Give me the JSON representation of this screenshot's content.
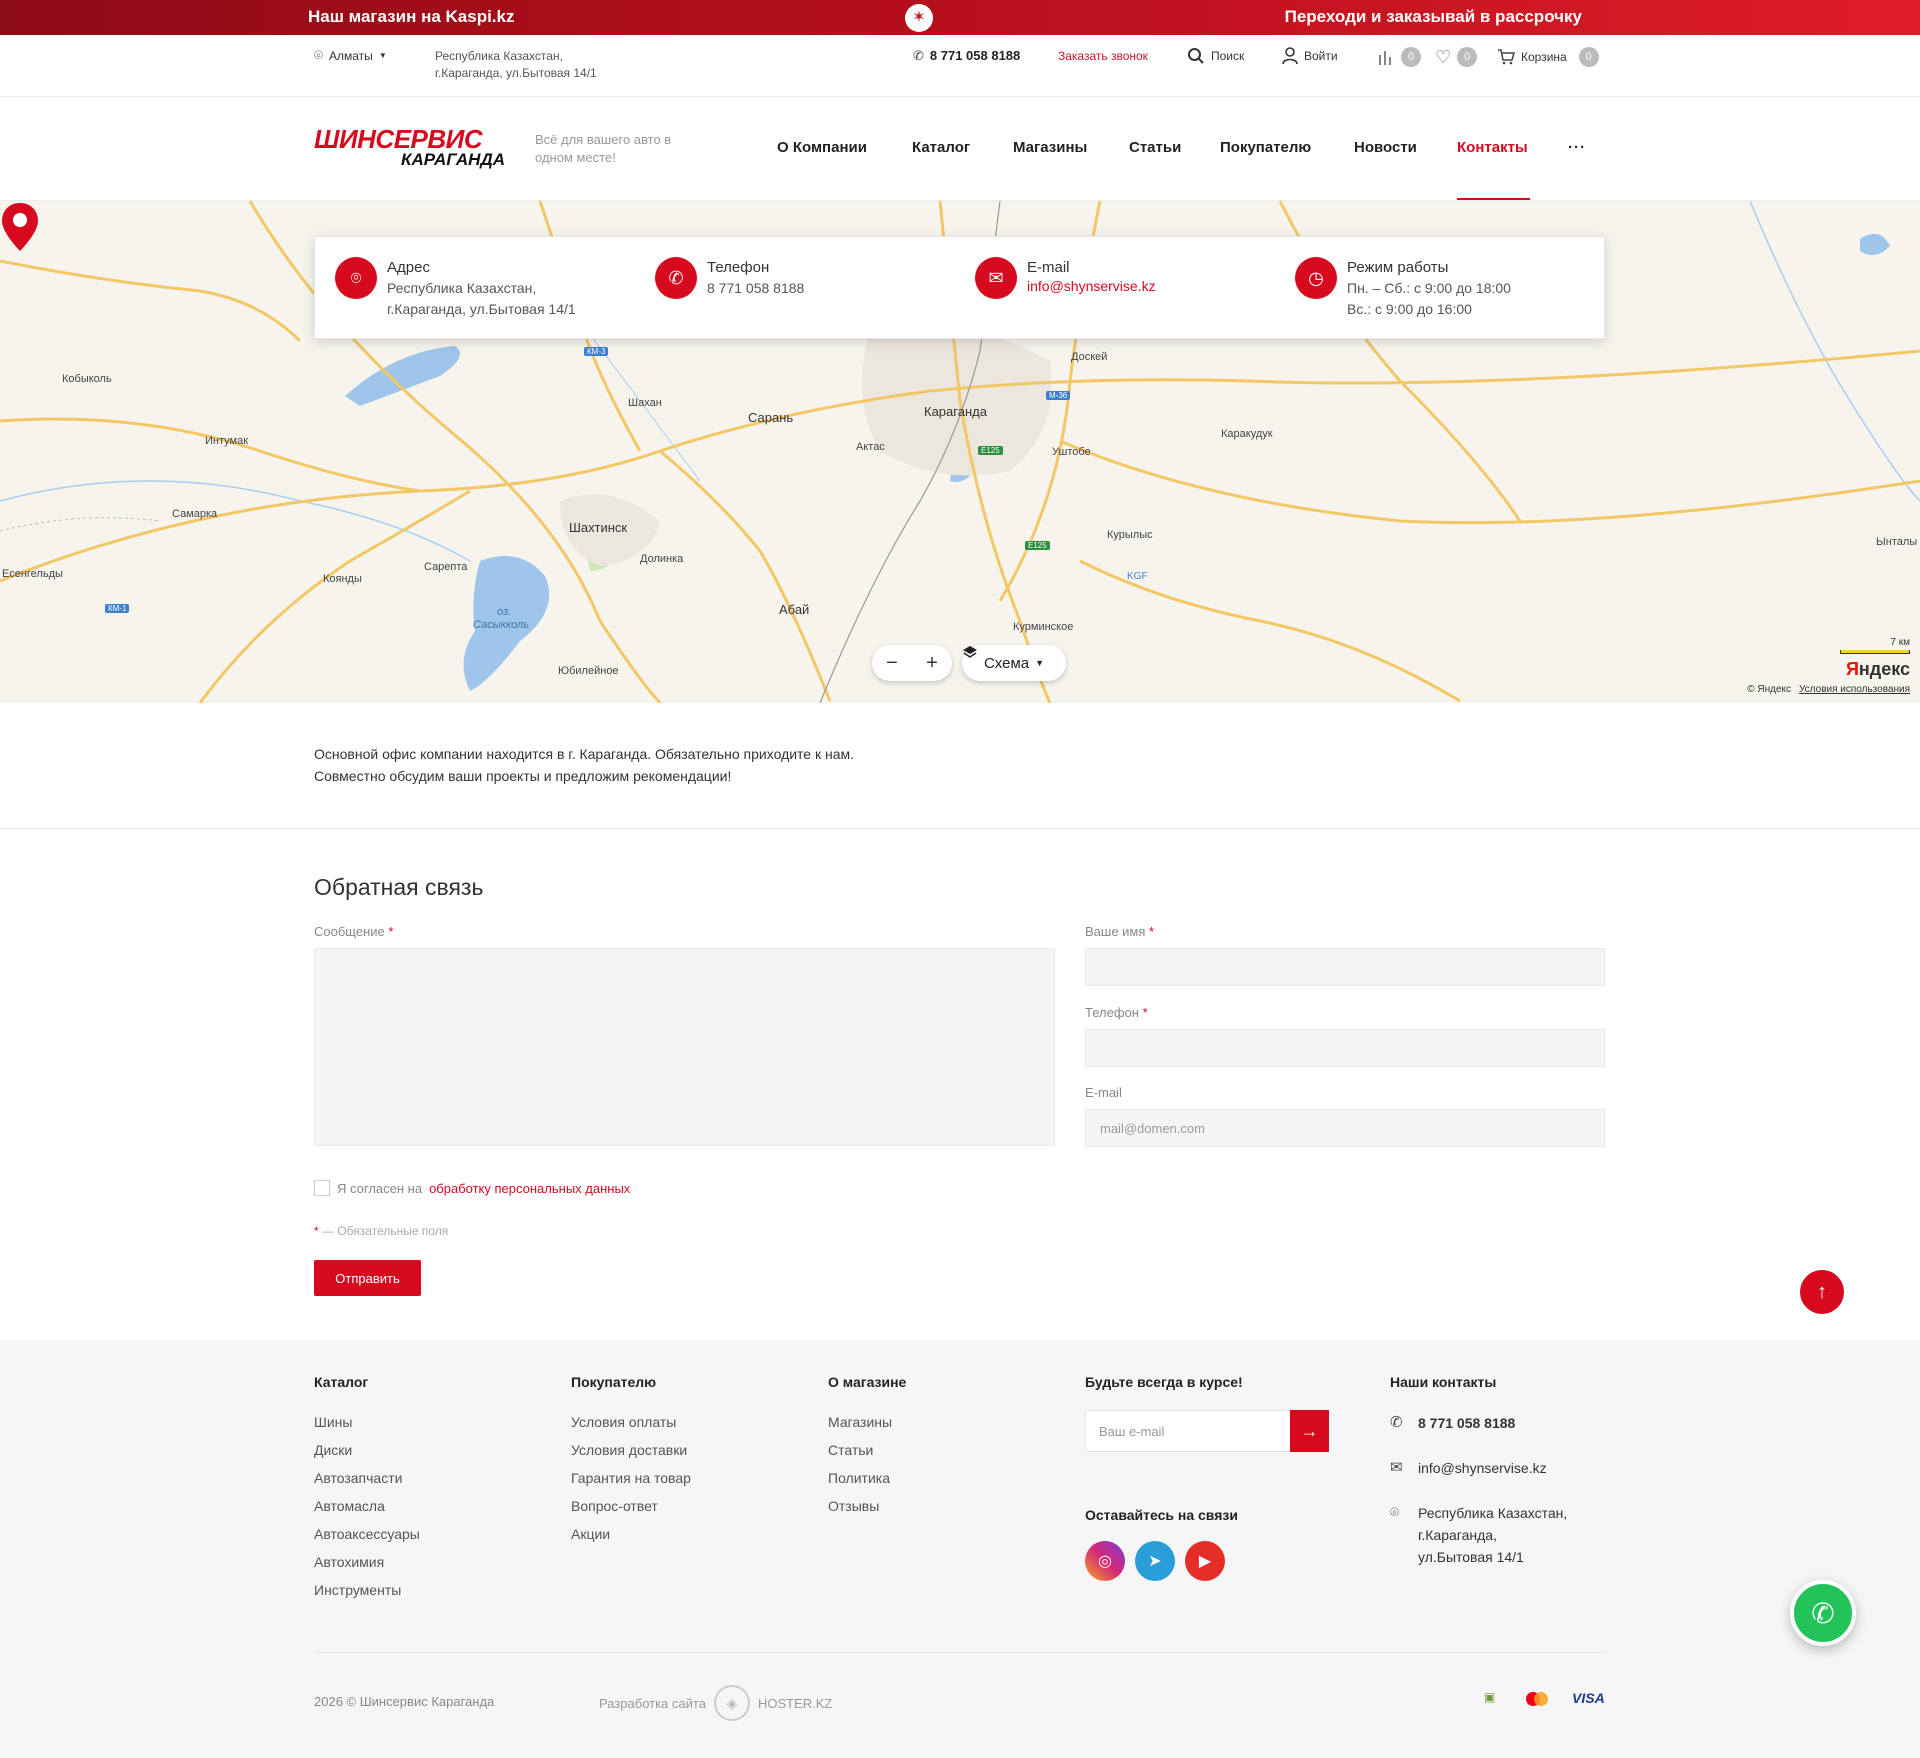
{
  "promo": {
    "left_text": "Наш магазин на Kaspi.kz",
    "right_text": "Переходи и заказывай в рассрочку"
  },
  "topbar": {
    "city": "Алматы",
    "address_line1": "Республика Казахстан,",
    "address_line2": "г.Караганда, ул.Бытовая 14/1",
    "phone": "8 771 058 8188",
    "callback": "Заказать звонок",
    "search": "Поиск",
    "login": "Войти",
    "compare_count": "0",
    "favorites_count": "0",
    "cart": "Корзина",
    "cart_count": "0"
  },
  "header": {
    "logo_top": "ШИНСЕРВИС",
    "logo_bottom": "КАРАГАНДА",
    "tagline": "Всё для вашего авто в одном месте!",
    "nav": [
      {
        "label": "О Компании"
      },
      {
        "label": "Каталог"
      },
      {
        "label": "Магазины"
      },
      {
        "label": "Статьи"
      },
      {
        "label": "Покупателю"
      },
      {
        "label": "Новости"
      },
      {
        "label": "Контакты",
        "active": true
      },
      {
        "label": "···"
      }
    ]
  },
  "contact_card": {
    "address_title": "Адрес",
    "address_line1": "Республика Казахстан,",
    "address_line2": "г.Караганда, ул.Бытовая 14/1",
    "phone_title": "Телефон",
    "phone": "8 771 058 8188",
    "email_title": "E-mail",
    "email": "info@shynservise.kz",
    "hours_title": "Режим работы",
    "hours_line1": "Пн. – Сб.: с 9:00 до 18:00",
    "hours_line2": "Вс.: с 9:00 до 16:00"
  },
  "map": {
    "labels": [
      "Кобыколь",
      "Интумак",
      "Самарка",
      "Есенгельды",
      "Коянды",
      "Сарепта",
      "Шахан",
      "Сарань",
      "Актас",
      "Шахтинск",
      "Долинка",
      "Абай",
      "Юбилейное",
      "Доскей",
      "Уштобе",
      "Каракудук",
      "Курылыс",
      "KGF",
      "Курминскоe",
      "Ынталы",
      "оз.",
      "Сасыкколь",
      "Караганда"
    ],
    "road_tags": [
      "КМ-3",
      "М-36",
      "E125",
      "E125",
      "КМ-1"
    ],
    "zoom_out": "−",
    "zoom_in": "+",
    "layer_label": "Схема",
    "scale": "7 км",
    "provider_logo_1": "Я",
    "provider_logo_2": "ндекс",
    "copyright": "© Яндекс",
    "terms": "Условия использования"
  },
  "about": {
    "line1": "Основной офис компании находится в г. Караганда. Обязательно приходите к нам.",
    "line2": "Совместно обсудим ваши проекты и предложим рекомендации!"
  },
  "form": {
    "title": "Обратная связь",
    "message_label": "Сообщение",
    "name_label": "Ваше имя",
    "phone_label": "Телефон",
    "email_label": "E-mail",
    "email_placeholder": "mail@domen.com",
    "consent_prefix": "Я согласен на",
    "consent_link": "обработку персональных данных",
    "required_star": "*",
    "required_note": "— Обязательные поля",
    "submit": "Отправить"
  },
  "footer": {
    "catalog_title": "Каталог",
    "catalog_items": [
      "Шины",
      "Диски",
      "Автозапчасти",
      "Автомасла",
      "Автоаксессуары",
      "Автохимия",
      "Инструменты"
    ],
    "buyer_title": "Покупателю",
    "buyer_items": [
      "Условия оплаты",
      "Условия доставки",
      "Гарантия на товар",
      "Вопрос-ответ",
      "Акции"
    ],
    "store_title": "О магазине",
    "store_items": [
      "Магазины",
      "Статьи",
      "Политика",
      "Отзывы"
    ],
    "subscribe_title": "Будьте всегда в курсе!",
    "subscribe_placeholder": "Ваш e-mail",
    "social_title": "Оставайтесь на связи",
    "contacts_title": "Наши контакты",
    "phone": "8 771 058 8188",
    "email": "info@shynservise.kz",
    "address_line1": "Республика Казахстан,",
    "address_line2": "г.Караганда,",
    "address_line3": "ул.Бытовая 14/1",
    "copyright": "2026 © Шинсервис Караганда",
    "developer_prefix": "Разработка сайта",
    "developer_name": "HOSTER.KZ",
    "payment_visa": "VISA"
  },
  "colors": {
    "accent": "#d6091f",
    "footer_bg": "#f6f6f6",
    "whatsapp": "#24c35a",
    "instagram": "#c7367f",
    "telegram": "#2a9ed8",
    "youtube": "#e52d27"
  }
}
